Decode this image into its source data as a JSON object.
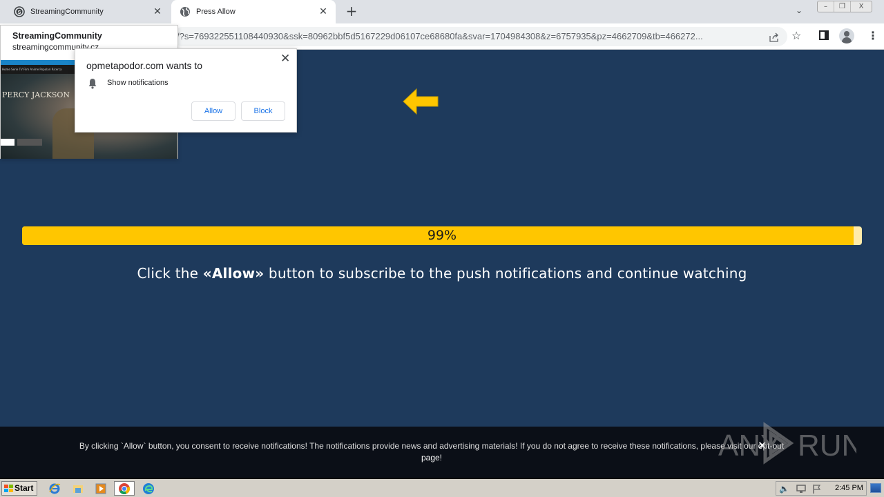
{
  "browser": {
    "tabs": [
      {
        "title": "StreamingCommunity",
        "icon": "streamingcommunity-favicon",
        "active": false
      },
      {
        "title": "Press Allow",
        "icon": "globe-icon",
        "active": true
      }
    ],
    "new_tab_symbol": "+",
    "tab_search_symbol": "⌄",
    "window_controls": {
      "minimize": "–",
      "restore": "❐",
      "close": "X"
    },
    "url": "/?s=769322551108440930&ssk=80962bbf5d5167229d06107ce68680fa&svar=1704984308&z=6757935&pz=4662709&tb=466272...",
    "toolbar_icons": [
      "share-icon",
      "bookmark-star-icon",
      "side-panel-icon",
      "profile-avatar-icon",
      "menu-kebab-icon"
    ]
  },
  "hover_card": {
    "title": "StreamingCommunity",
    "domain": "streamingcommunity.cz",
    "preview_nav": "Home  Serie TV  Film  Anime  Popolari  Ricerca",
    "preview_logo": "PERCY JACKSON"
  },
  "permission_prompt": {
    "title": "opmetapodor.com wants to",
    "permission": "Show notifications",
    "allow_label": "Allow",
    "block_label": "Block",
    "close_symbol": "✕"
  },
  "page": {
    "progress_percent": 99,
    "progress_label": "99%",
    "headline_prefix": "Click the ",
    "headline_bold": "«Allow»",
    "headline_suffix": " button to subscribe to the push notifications and continue watching",
    "colors": {
      "background": "#1e3a5c",
      "accent": "#ffc600",
      "progress_track": "#ffebaa"
    }
  },
  "consent_bar": {
    "text_before_link": "By clicking `Allow` button, you consent to receive notifications! The notifications provide news and advertising materials! If you do not agree to receive these notifications, please visit our ",
    "link_text": "opt-out page",
    "text_after_link": "!",
    "close_symbol": "×"
  },
  "watermark": {
    "text_left": "ANY",
    "text_right": "RUN"
  },
  "taskbar": {
    "start_label": "Start",
    "pinned": [
      "internet-explorer-icon",
      "file-explorer-icon",
      "media-player-icon",
      "chrome-icon",
      "edge-icon"
    ],
    "tray_icons": [
      "volume-icon",
      "network-icon",
      "action-center-flag-icon"
    ],
    "clock": "2:45 PM"
  }
}
